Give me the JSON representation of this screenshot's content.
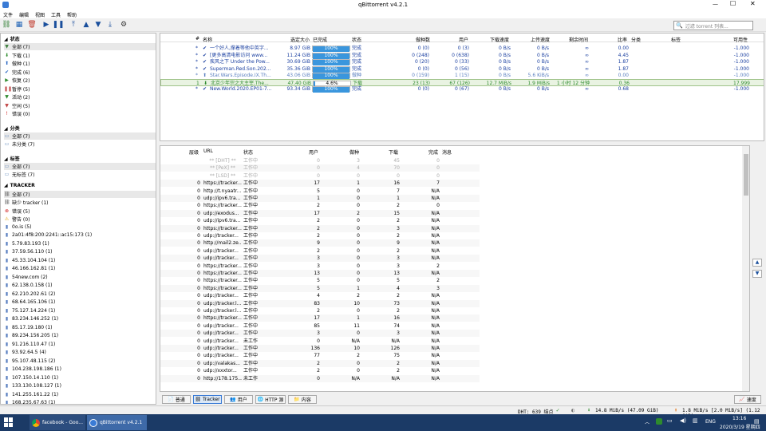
{
  "window": {
    "title": "qBittorrent v4.2.1"
  },
  "menu": [
    "文件",
    "编辑",
    "视图",
    "工具",
    "帮助"
  ],
  "search": {
    "placeholder": "过滤 torrent 列表..."
  },
  "sidebar": {
    "status_header": "状态",
    "status": [
      {
        "label": "全部 (7)",
        "icon": "filter-icon",
        "color": "#3a7d3a"
      },
      {
        "label": "下载 (1)",
        "icon": "download-arrow-icon",
        "color": "#2e8b2e"
      },
      {
        "label": "做种 (1)",
        "icon": "upload-arrow-icon",
        "color": "#2060c0"
      },
      {
        "label": "完成 (6)",
        "icon": "check-icon",
        "color": "#2060c0"
      },
      {
        "label": "恢复 (2)",
        "icon": "play-icon",
        "color": "#2e8b2e"
      },
      {
        "label": "暂停 (5)",
        "icon": "pause-icon",
        "color": "#c04040"
      },
      {
        "label": "活动 (2)",
        "icon": "filter-icon",
        "color": "#2e8b2e"
      },
      {
        "label": "空闲 (5)",
        "icon": "filter-icon",
        "color": "#c04040"
      },
      {
        "label": "错误 (0)",
        "icon": "error-icon",
        "color": "#d02020"
      }
    ],
    "categories_header": "分类",
    "categories": [
      "全部 (7)",
      "未分类 (7)"
    ],
    "tags_header": "标签",
    "tags": [
      "全部 (7)",
      "无标签 (7)"
    ],
    "trackers_header": "TRACKER",
    "trackers": [
      "全部 (7)",
      "缺少 tracker (1)",
      "错误 (5)",
      "警告 (0)",
      "0o.is (5)",
      "2a01:4f8:200:2241::ac15:173 (1)",
      "5.79.83.193 (1)",
      "37.59.56.110 (1)",
      "45.33.104.104 (1)",
      "46.166.162.81 (1)",
      "54new.com (2)",
      "62.138.0.158 (1)",
      "62.210.202.61 (2)",
      "68.64.165.106 (1)",
      "75.127.14.224 (1)",
      "83.234.146.252 (1)",
      "85.17.19.180 (1)",
      "89.234.156.205 (1)",
      "91.216.110.47 (1)",
      "93.92.64.5 (4)",
      "95.107.48.115 (2)",
      "104.238.198.186 (1)",
      "107.150.14.110 (1)",
      "133.130.108.127 (1)",
      "141.255.161.22 (1)",
      "168.235.67.63 (1)"
    ]
  },
  "torrents": {
    "headers": [
      "#",
      "名称",
      "选定大小",
      "已完成",
      "状态",
      "做种数",
      "用户",
      "下载速度",
      "上传速度",
      "剩余时间",
      "比率",
      "分类",
      "标签",
      "可用性"
    ],
    "rows": [
      {
        "num": "*",
        "name": "一个好人,撑着等他中英字...",
        "size": "8.97 GiB",
        "progress": "100%",
        "pct": 100,
        "status": "完成",
        "seeds": "0 (0)",
        "peers": "0 (3)",
        "dl": "0 B/s",
        "ul": "0 B/s",
        "eta": "∞",
        "ratio": "0.00",
        "avail": "-1.000",
        "state": "complete"
      },
      {
        "num": "*",
        "name": "[更多高清电影访问 www...",
        "size": "11.24 GiB",
        "progress": "100%",
        "pct": 100,
        "status": "完成",
        "seeds": "0 (248)",
        "peers": "0 (638)",
        "dl": "0 B/s",
        "ul": "0 B/s",
        "eta": "∞",
        "ratio": "4.45",
        "avail": "-1.000",
        "state": "complete"
      },
      {
        "num": "*",
        "name": "疾风之下 Under the Pow...",
        "size": "30.69 GiB",
        "progress": "100%",
        "pct": 100,
        "status": "完成",
        "seeds": "0 (20)",
        "peers": "0 (33)",
        "dl": "0 B/s",
        "ul": "0 B/s",
        "eta": "∞",
        "ratio": "1.87",
        "avail": "-1.000",
        "state": "complete"
      },
      {
        "num": "*",
        "name": "Superman.Red.Son.202...",
        "size": "35.36 GiB",
        "progress": "100%",
        "pct": 100,
        "status": "完成",
        "seeds": "0 (0)",
        "peers": "0 (56)",
        "dl": "0 B/s",
        "ul": "0 B/s",
        "eta": "∞",
        "ratio": "1.87",
        "avail": "-1.000",
        "state": "complete"
      },
      {
        "num": "*",
        "name": "Star.Wars.Episode.IX.Th...",
        "size": "43.06 GiB",
        "progress": "100%",
        "pct": 100,
        "status": "做种",
        "seeds": "0 (159)",
        "peers": "1 (15)",
        "dl": "0 B/s",
        "ul": "5.6 KiB/s",
        "eta": "∞",
        "ratio": "0.00",
        "avail": "-1.000",
        "state": "seeding"
      },
      {
        "num": "1",
        "name": "北京少年宗之大主宰.The...",
        "size": "47.40 GiB",
        "progress": "4.6%",
        "pct": 4.6,
        "status": "下载",
        "seeds": "23 (13)",
        "peers": "67 (126)",
        "dl": "12.7 MiB/s",
        "ul": "1.9 MiB/s",
        "eta": "1 小时 12 分钟",
        "ratio": "0.36",
        "avail": "17.999",
        "state": "downloading"
      },
      {
        "num": "*",
        "name": "New.World.2020.EP01-7...",
        "size": "93.34 GiB",
        "progress": "100%",
        "pct": 100,
        "status": "完成",
        "seeds": "0 (0)",
        "peers": "0 (67)",
        "dl": "0 B/s",
        "ul": "0 B/s",
        "eta": "∞",
        "ratio": "0.68",
        "avail": "-1.000",
        "state": "complete"
      }
    ]
  },
  "trackers_panel": {
    "headers": [
      "层级",
      "URL",
      "状态",
      "用户",
      "做种",
      "下载",
      "完成",
      "消息"
    ],
    "rows": [
      {
        "tier": "",
        "url": "** [DHT] **",
        "status": "工作中",
        "peers": "0",
        "seeds": "3",
        "dl": "45",
        "done": "0",
        "special": true
      },
      {
        "tier": "",
        "url": "** [PeX] **",
        "status": "工作中",
        "peers": "0",
        "seeds": "4",
        "dl": "70",
        "done": "0",
        "special": true
      },
      {
        "tier": "",
        "url": "** [LSD] **",
        "status": "工作中",
        "peers": "0",
        "seeds": "0",
        "dl": "0",
        "done": "0",
        "special": true
      },
      {
        "tier": "0",
        "url": "https://tracker...",
        "status": "工作中",
        "peers": "17",
        "seeds": "1",
        "dl": "16",
        "done": "7"
      },
      {
        "tier": "0",
        "url": "http://t.nyaatr...",
        "status": "工作中",
        "peers": "5",
        "seeds": "0",
        "dl": "7",
        "done": "N/A"
      },
      {
        "tier": "0",
        "url": "udp://ipv6.tra...",
        "status": "工作中",
        "peers": "1",
        "seeds": "0",
        "dl": "1",
        "done": "N/A"
      },
      {
        "tier": "0",
        "url": "https://tracker...",
        "status": "工作中",
        "peers": "2",
        "seeds": "0",
        "dl": "2",
        "done": "0"
      },
      {
        "tier": "0",
        "url": "udp://exodus...",
        "status": "工作中",
        "peers": "17",
        "seeds": "2",
        "dl": "15",
        "done": "N/A"
      },
      {
        "tier": "0",
        "url": "udp://ipv6.tra...",
        "status": "工作中",
        "peers": "2",
        "seeds": "0",
        "dl": "2",
        "done": "N/A"
      },
      {
        "tier": "0",
        "url": "https://tracker...",
        "status": "工作中",
        "peers": "2",
        "seeds": "0",
        "dl": "3",
        "done": "N/A"
      },
      {
        "tier": "0",
        "url": "udp://tracker...",
        "status": "工作中",
        "peers": "2",
        "seeds": "0",
        "dl": "2",
        "done": "N/A"
      },
      {
        "tier": "0",
        "url": "http://mail2.ze...",
        "status": "工作中",
        "peers": "9",
        "seeds": "0",
        "dl": "9",
        "done": "N/A"
      },
      {
        "tier": "0",
        "url": "udp://tracker...",
        "status": "工作中",
        "peers": "2",
        "seeds": "0",
        "dl": "2",
        "done": "N/A"
      },
      {
        "tier": "0",
        "url": "udp://tracker...",
        "status": "工作中",
        "peers": "3",
        "seeds": "0",
        "dl": "3",
        "done": "N/A"
      },
      {
        "tier": "0",
        "url": "https://tracker...",
        "status": "工作中",
        "peers": "3",
        "seeds": "0",
        "dl": "3",
        "done": "2"
      },
      {
        "tier": "0",
        "url": "https://tracker...",
        "status": "工作中",
        "peers": "13",
        "seeds": "0",
        "dl": "13",
        "done": "N/A"
      },
      {
        "tier": "0",
        "url": "https://tracker...",
        "status": "工作中",
        "peers": "5",
        "seeds": "0",
        "dl": "5",
        "done": "2"
      },
      {
        "tier": "0",
        "url": "https://tracker...",
        "status": "工作中",
        "peers": "5",
        "seeds": "1",
        "dl": "4",
        "done": "3"
      },
      {
        "tier": "0",
        "url": "udp://tracker...",
        "status": "工作中",
        "peers": "4",
        "seeds": "2",
        "dl": "2",
        "done": "N/A"
      },
      {
        "tier": "0",
        "url": "udp://tracker.l...",
        "status": "工作中",
        "peers": "83",
        "seeds": "10",
        "dl": "73",
        "done": "N/A"
      },
      {
        "tier": "0",
        "url": "udp://tracker.l...",
        "status": "工作中",
        "peers": "2",
        "seeds": "0",
        "dl": "2",
        "done": "N/A"
      },
      {
        "tier": "0",
        "url": "https://tracker...",
        "status": "工作中",
        "peers": "17",
        "seeds": "1",
        "dl": "16",
        "done": "N/A"
      },
      {
        "tier": "0",
        "url": "udp://tracker...",
        "status": "工作中",
        "peers": "85",
        "seeds": "11",
        "dl": "74",
        "done": "N/A"
      },
      {
        "tier": "0",
        "url": "udp://tracker...",
        "status": "工作中",
        "peers": "3",
        "seeds": "0",
        "dl": "3",
        "done": "N/A"
      },
      {
        "tier": "0",
        "url": "udp://tracker...",
        "status": "未工作",
        "peers": "0",
        "seeds": "N/A",
        "dl": "N/A",
        "done": "N/A"
      },
      {
        "tier": "0",
        "url": "udp://tracker...",
        "status": "工作中",
        "peers": "136",
        "seeds": "10",
        "dl": "126",
        "done": "N/A"
      },
      {
        "tier": "0",
        "url": "udp://tracker...",
        "status": "工作中",
        "peers": "77",
        "seeds": "2",
        "dl": "75",
        "done": "N/A"
      },
      {
        "tier": "0",
        "url": "udp://valakas...",
        "status": "工作中",
        "peers": "2",
        "seeds": "0",
        "dl": "2",
        "done": "N/A"
      },
      {
        "tier": "0",
        "url": "udp://xxxtor...",
        "status": "工作中",
        "peers": "2",
        "seeds": "0",
        "dl": "2",
        "done": "N/A"
      },
      {
        "tier": "0",
        "url": "http://178.175...",
        "status": "未工作",
        "peers": "0",
        "seeds": "N/A",
        "dl": "N/A",
        "done": "N/A"
      }
    ]
  },
  "tabs": [
    "普通",
    "Tracker",
    "用户",
    "HTTP 源",
    "内容"
  ],
  "speed_btn": "速度",
  "statusbar": {
    "dht": "DHT: 639 结点",
    "dl": "14.8 MiB/s (47.09 GiB)",
    "ul": "1.8 MiB/s [2.0 MiB/s] (1.12 GiB)"
  },
  "taskbar": {
    "items": [
      "facebook - Goo...",
      "qBittorrent v4.2.1"
    ],
    "lang": "ENG",
    "time": "13:16",
    "date": "2020/3/19 星期四"
  },
  "colors": {
    "progress": "#3a96dd",
    "downloading": "#2e8b2e",
    "complete": "#1a3fa0",
    "seeding": "#5a7fc0",
    "selected": "#e9f3e2"
  }
}
